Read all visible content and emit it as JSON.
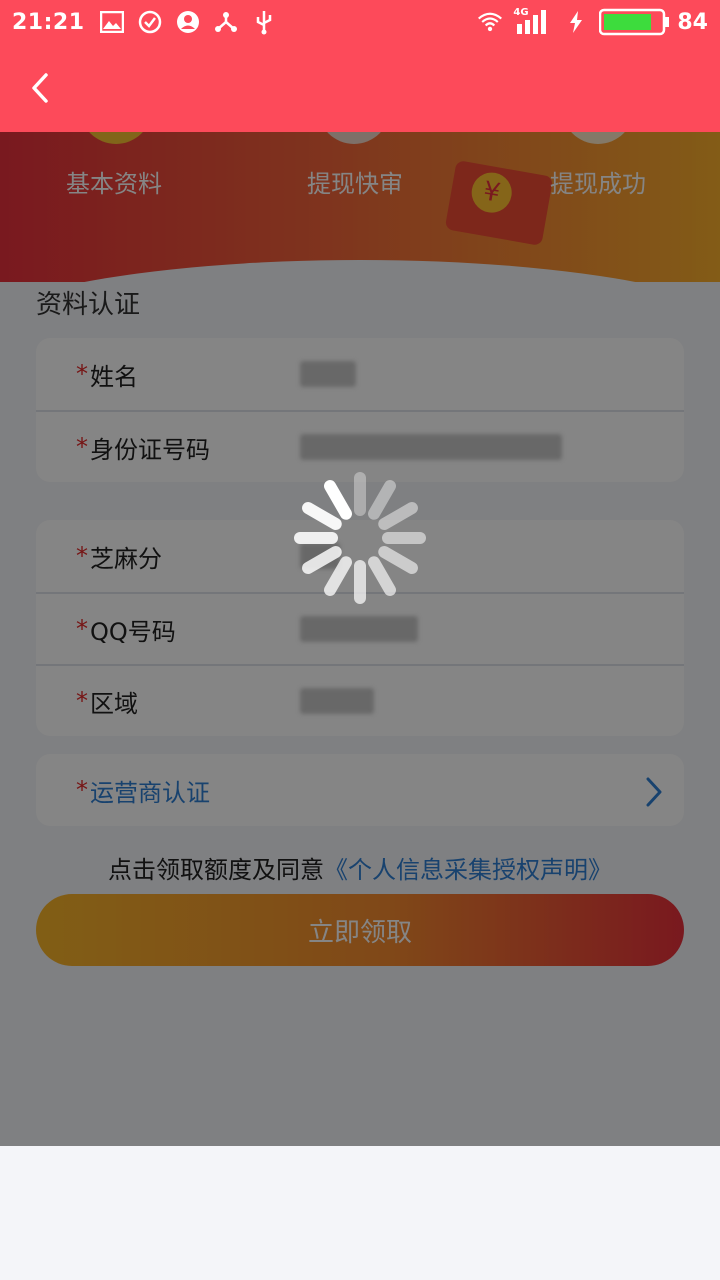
{
  "status_bar": {
    "time": "21:21",
    "network": "4G",
    "battery_level": "84",
    "battery_fraction": 0.84,
    "icons_left": [
      "image-icon",
      "check-circle-icon",
      "account-icon",
      "share-icon",
      "usb-icon"
    ],
    "icons_right": [
      "wifi-icon",
      "signal-icon",
      "charging-icon",
      "battery-icon"
    ]
  },
  "header": {
    "back_icon": "chevron-left-icon",
    "bar_color": "#fd4a5a"
  },
  "steps": [
    {
      "label": "基本资料"
    },
    {
      "label": "提现快审"
    },
    {
      "label": "提现成功"
    }
  ],
  "form": {
    "section_title": "资料认证",
    "required_mark": "*",
    "group1": [
      {
        "label": "姓名",
        "value_obscured": true
      },
      {
        "label": "身份证号码",
        "value_obscured": true
      }
    ],
    "group2": [
      {
        "label": "芝麻分",
        "value_obscured": true
      },
      {
        "label": "QQ号码",
        "value_obscured": true
      },
      {
        "label": "区域",
        "value_obscured": true
      }
    ],
    "carrier": {
      "label": "运营商认证",
      "icon": "chevron-right-icon"
    }
  },
  "agreement": {
    "text": "点击领取额度及同意",
    "link": "《个人信息采集授权声明》"
  },
  "claim_button": {
    "label": "立即领取"
  },
  "loading": {
    "visible": true,
    "icon": "loading-spinner-icon"
  },
  "colors": {
    "accent_red": "#fd4a5a",
    "link_blue": "#2f7fd4",
    "required_red": "#e22a2a",
    "gradient_start": "#f8b52a",
    "gradient_end": "#e9303c"
  }
}
